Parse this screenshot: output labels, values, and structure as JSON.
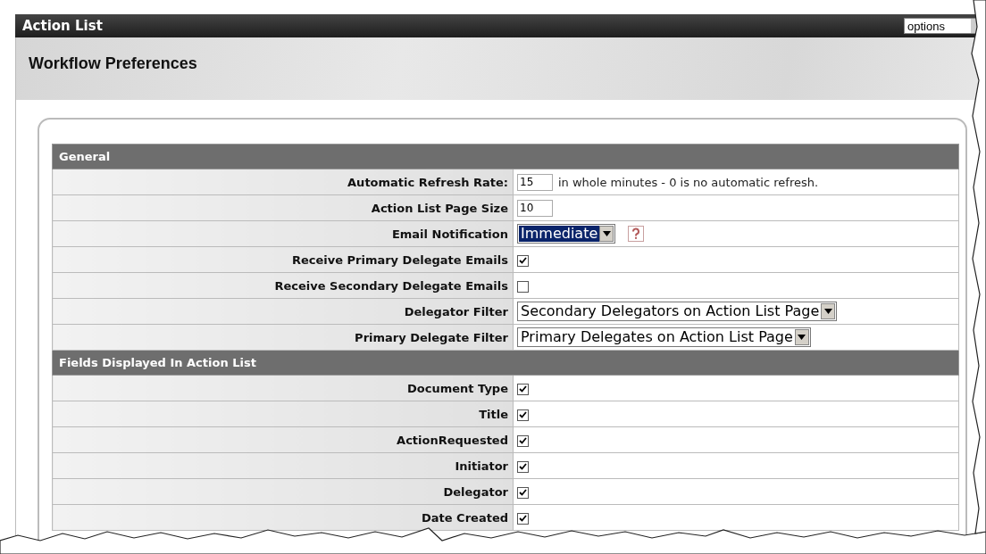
{
  "window": {
    "title": "Action List",
    "options_select": {
      "value": "options"
    }
  },
  "page_title": "Workflow Preferences",
  "sections": [
    {
      "title": "General",
      "rows": [
        {
          "label": "Automatic Refresh Rate:",
          "kind": "text",
          "value": "15",
          "note": "in whole minutes - 0 is no automatic refresh."
        },
        {
          "label": "Action List Page Size",
          "kind": "text",
          "value": "10"
        },
        {
          "label": "Email Notification",
          "kind": "select",
          "value": "Immediate",
          "focused": true,
          "help": true
        },
        {
          "label": "Receive Primary Delegate Emails",
          "kind": "checkbox",
          "checked": true
        },
        {
          "label": "Receive Secondary Delegate Emails",
          "kind": "checkbox",
          "checked": false
        },
        {
          "label": "Delegator Filter",
          "kind": "select",
          "value": "Secondary Delegators on Action List Page",
          "focused": false,
          "help": false
        },
        {
          "label": "Primary Delegate Filter",
          "kind": "select",
          "value": "Primary Delegates on Action List Page",
          "focused": false,
          "help": false
        }
      ]
    },
    {
      "title": "Fields Displayed In Action List",
      "rows": [
        {
          "label": "Document Type",
          "kind": "checkbox",
          "checked": true
        },
        {
          "label": "Title",
          "kind": "checkbox",
          "checked": true
        },
        {
          "label": "ActionRequested",
          "kind": "checkbox",
          "checked": true
        },
        {
          "label": "Initiator",
          "kind": "checkbox",
          "checked": true
        },
        {
          "label": "Delegator",
          "kind": "checkbox",
          "checked": true
        },
        {
          "label": "Date Created",
          "kind": "checkbox",
          "checked": true
        }
      ]
    }
  ]
}
